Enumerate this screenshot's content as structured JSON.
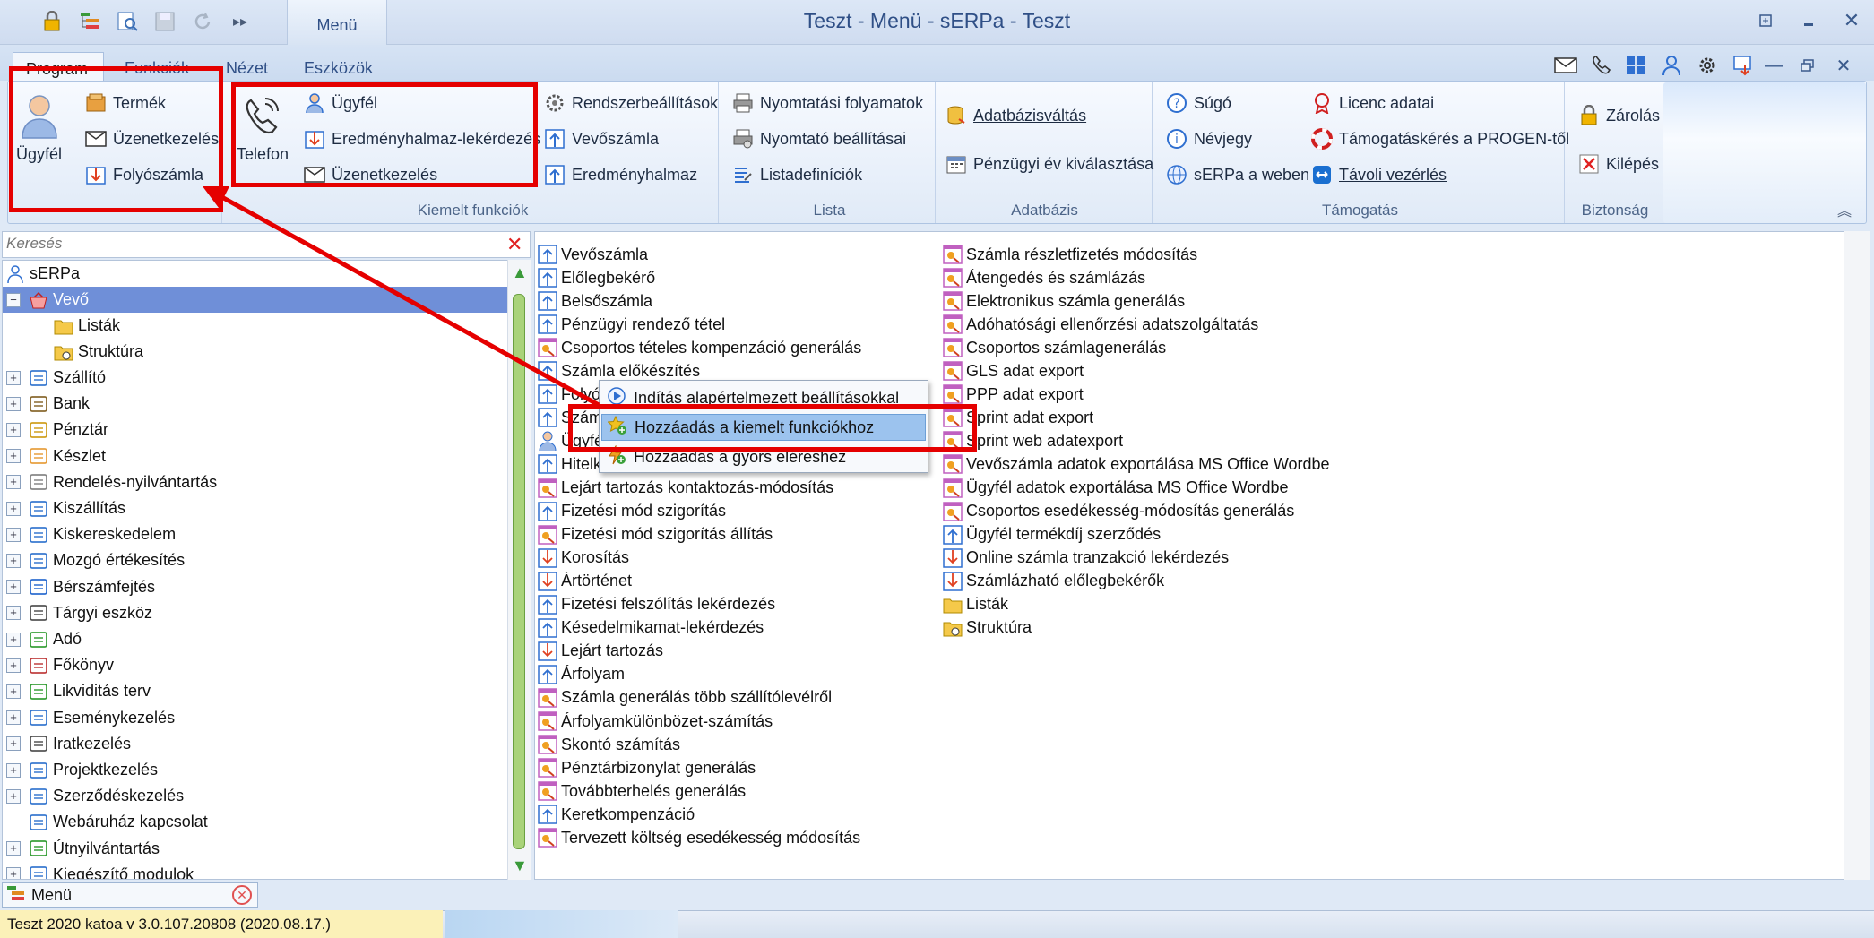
{
  "window": {
    "title": "Teszt - Menü - sERPa - Teszt",
    "context_tab": "Menü"
  },
  "quick_access": [
    "lock-icon",
    "tree-list-icon",
    "search-doc-icon",
    "save-icon",
    "refresh-icon",
    "more-icon"
  ],
  "tabs": [
    {
      "label": "Program",
      "active": true
    },
    {
      "label": "Funkciók"
    },
    {
      "label": "Nézet"
    },
    {
      "label": "Eszközök"
    }
  ],
  "ribbon": {
    "program_group": {
      "big": "Ügyfél",
      "items": [
        "Termék",
        "Üzenetkezelés",
        "Folyószámla"
      ]
    },
    "kiemelt": {
      "label": "Kiemelt funkciók",
      "big": "Telefon",
      "items": [
        "Ügyfél",
        "Eredményhalmaz-lekérdezés",
        "Üzenetkezelés"
      ],
      "items2": [
        "Rendszerbeállítások",
        "Vevőszámla",
        "Eredményhalmaz"
      ]
    },
    "lista": {
      "label": "Lista",
      "items": [
        "Nyomtatási folyamatok",
        "Nyomtató beállításai",
        "Listadefiníciók"
      ]
    },
    "adatbazis": {
      "label": "Adatbázis",
      "items": [
        "Adatbázisváltás",
        "Pénzügyi év kiválasztása"
      ]
    },
    "tamogatas": {
      "label": "Támogatás",
      "items": [
        "Súgó",
        "Névjegy",
        "sERPa a weben"
      ],
      "items2": [
        "Licenc adatai",
        "Támogatáskérés a PROGEN-től",
        "Távoli vezérlés"
      ]
    },
    "biztonsag": {
      "label": "Biztonság",
      "items": [
        "Zárolás",
        "Kilépés"
      ]
    }
  },
  "search": {
    "placeholder": "Keresés"
  },
  "tree": {
    "root": "sERPa",
    "selected": "Vevő",
    "vevo_children": [
      "Listák",
      "Struktúra"
    ],
    "items": [
      "Szállító",
      "Bank",
      "Pénztár",
      "Készlet",
      "Rendelés-nyilvántartás",
      "Kiszállítás",
      "Kiskereskedelem",
      "Mozgó értékesítés",
      "Bérszámfejtés",
      "Tárgyi eszköz",
      "Adó",
      "Főkönyv",
      "Likviditás terv",
      "Eseménykezelés",
      "Iratkezelés",
      "Projektkezelés",
      "Szerződéskezelés",
      "Webáruház kapcsolat",
      "Útnyilvántartás",
      "Kiegészítő modulok"
    ]
  },
  "bottom_tab": {
    "label": "Menü"
  },
  "content": {
    "col1": [
      {
        "t": "Vevőszámla",
        "i": "up"
      },
      {
        "t": "Előlegbekérő",
        "i": "up"
      },
      {
        "t": "Belsőszámla",
        "i": "up"
      },
      {
        "t": "Pénzügyi rendező tétel",
        "i": "up"
      },
      {
        "t": "Csoportos tételes kompenzáció generálás",
        "i": "gen"
      },
      {
        "t": "Számla előkészítés",
        "i": "up"
      },
      {
        "t": "Folyószámla",
        "i": "up"
      },
      {
        "t": "Számla",
        "i": "up"
      },
      {
        "t": "Ügyfél",
        "i": "user"
      },
      {
        "t": "Hitelkeret",
        "i": "up"
      },
      {
        "t": "Lejárt tartozás kontaktozás-módosítás",
        "i": "gen"
      },
      {
        "t": "Fizetési mód szigorítás",
        "i": "up"
      },
      {
        "t": "Fizetési mód szigorítás állítás",
        "i": "gen"
      },
      {
        "t": "Korosítás",
        "i": "down"
      },
      {
        "t": "Ártörténet",
        "i": "down"
      },
      {
        "t": "Fizetési felszólítás lekérdezés",
        "i": "up"
      },
      {
        "t": "Késedelmikamat-lekérdezés",
        "i": "up"
      },
      {
        "t": "Lejárt tartozás",
        "i": "down"
      },
      {
        "t": "Árfolyam",
        "i": "up"
      },
      {
        "t": "Számla generálás több szállítólevélről",
        "i": "gen"
      },
      {
        "t": "Árfolyamkülönbözet-számítás",
        "i": "gen"
      },
      {
        "t": "Skontó számítás",
        "i": "gen"
      },
      {
        "t": "Pénztárbizonylat generálás",
        "i": "gen"
      },
      {
        "t": "Továbbterhelés generálás",
        "i": "gen"
      },
      {
        "t": "Keretkompenzáció",
        "i": "up"
      },
      {
        "t": "Tervezett költség esedékesség módosítás",
        "i": "gen"
      }
    ],
    "col2": [
      {
        "t": "Számla részletfizetés módosítás",
        "i": "gen"
      },
      {
        "t": "Átengedés és számlázás",
        "i": "gen"
      },
      {
        "t": "Elektronikus számla generálás",
        "i": "gen"
      },
      {
        "t": "Adóhatósági ellenőrzési adatszolgáltatás",
        "i": "gen"
      },
      {
        "t": "Csoportos számlagenerálás",
        "i": "gen"
      },
      {
        "t": "GLS adat export",
        "i": "gen"
      },
      {
        "t": "PPP adat export",
        "i": "gen"
      },
      {
        "t": "Sprint adat export",
        "i": "gen"
      },
      {
        "t": "Sprint web adatexport",
        "i": "gen"
      },
      {
        "t": "Vevőszámla adatok exportálása MS Office Wordbe",
        "i": "gen"
      },
      {
        "t": "Ügyfél adatok exportálása MS Office Wordbe",
        "i": "gen"
      },
      {
        "t": "Csoportos esedékesség-módosítás generálás",
        "i": "gen"
      },
      {
        "t": "Ügyfél termékdíj szerződés",
        "i": "up"
      },
      {
        "t": "Online számla tranzakció lekérdezés",
        "i": "down"
      },
      {
        "t": "Számlázható előlegbekérők",
        "i": "down"
      },
      {
        "t": "Listák",
        "i": "folder"
      },
      {
        "t": "Struktúra",
        "i": "struct"
      }
    ]
  },
  "context_menu": {
    "items": [
      "Indítás alapértelmezett beállításokkal",
      "Hozzáadás a kiemelt funkciókhoz",
      "Hozzáadás a gyors eléréshez"
    ],
    "highlighted": 1
  },
  "status": {
    "text": "Teszt   2020   katoa   v 3.0.107.20808 (2020.08.17.)"
  },
  "colors": {
    "annotation_red": "#e50000",
    "selected_row": "#6f8fd8",
    "highlight": "#9cc3ee"
  }
}
